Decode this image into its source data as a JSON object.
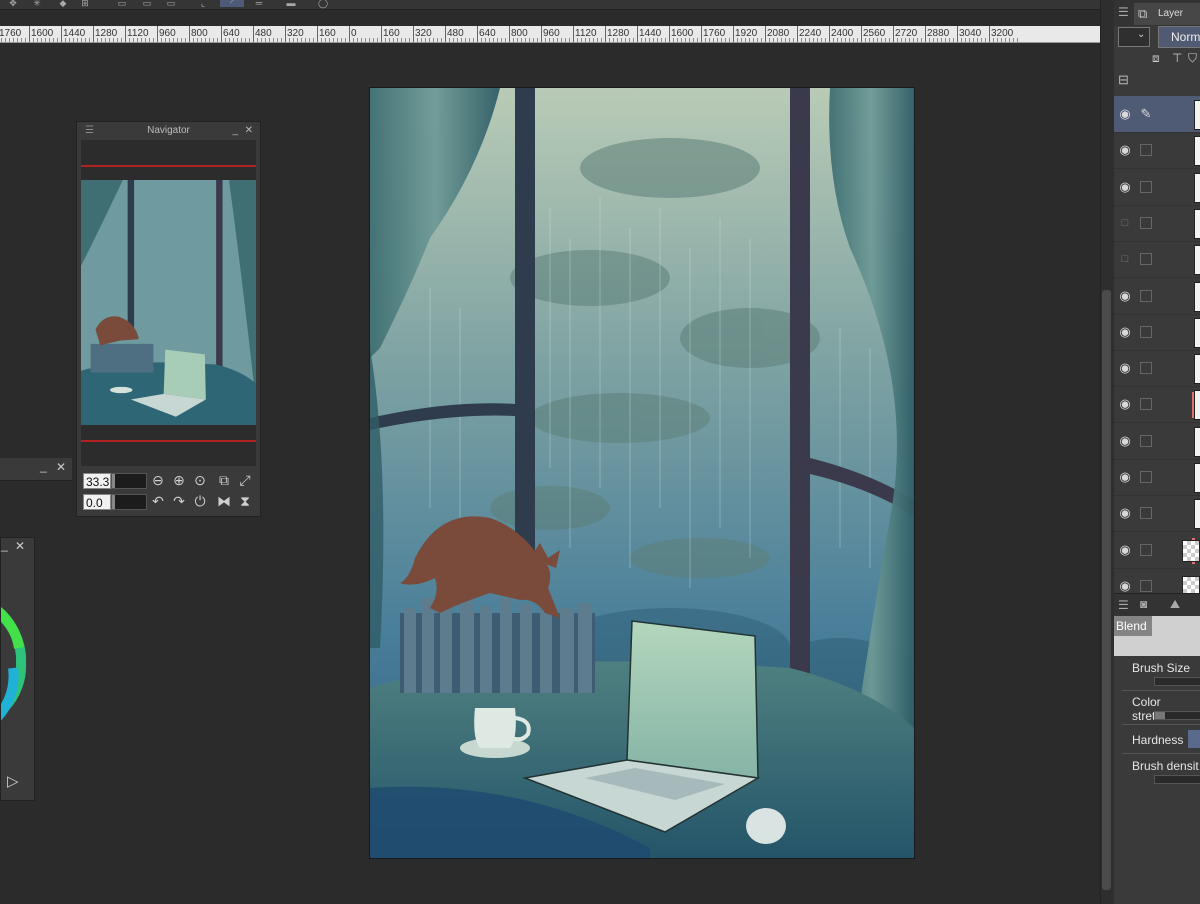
{
  "navigator": {
    "title": "Navigator",
    "zoom_value": "33.3",
    "rotation_value": "0.0"
  },
  "ruler": {
    "labels": [
      "1760",
      "1600",
      "1440",
      "1280",
      "1120",
      "960",
      "800",
      "640",
      "480",
      "320",
      "160",
      "0",
      "160",
      "320",
      "480",
      "640",
      "800",
      "960",
      "1120",
      "1280",
      "1440",
      "1600",
      "1760",
      "1920",
      "2080",
      "2240",
      "2400",
      "2560",
      "2720",
      "2880",
      "3040",
      "3200"
    ]
  },
  "layer_panel": {
    "tab_label": "Layer",
    "blend_mode": "Norm",
    "rows": [
      {
        "visible": true,
        "selected": true,
        "marker": false,
        "checker": false
      },
      {
        "visible": true,
        "selected": false,
        "marker": false,
        "checker": false
      },
      {
        "visible": true,
        "selected": false,
        "marker": false,
        "checker": false
      },
      {
        "visible": false,
        "selected": false,
        "marker": false,
        "checker": false
      },
      {
        "visible": false,
        "selected": false,
        "marker": false,
        "checker": false
      },
      {
        "visible": true,
        "selected": false,
        "marker": false,
        "checker": false
      },
      {
        "visible": true,
        "selected": false,
        "marker": false,
        "checker": false
      },
      {
        "visible": true,
        "selected": false,
        "marker": false,
        "checker": false
      },
      {
        "visible": true,
        "selected": false,
        "marker": true,
        "checker": false
      },
      {
        "visible": true,
        "selected": false,
        "marker": false,
        "checker": false
      },
      {
        "visible": true,
        "selected": false,
        "marker": false,
        "checker": false
      },
      {
        "visible": true,
        "selected": false,
        "marker": false,
        "checker": false
      },
      {
        "visible": true,
        "selected": false,
        "marker": true,
        "checker": true
      },
      {
        "visible": true,
        "selected": false,
        "marker": false,
        "checker": true
      }
    ]
  },
  "tool_property": {
    "header": "Blend",
    "brush_size_label": "Brush Size",
    "color_stretch_label": "Color stretch",
    "hardness_label": "Hardness",
    "brush_density_label": "Brush densit"
  },
  "colors": {
    "bg": "#2b2b2b",
    "panel": "#3a3a3a",
    "accent": "#4d5b78",
    "navigator_frame": "#b12222",
    "layer_marker": "#e07070"
  }
}
